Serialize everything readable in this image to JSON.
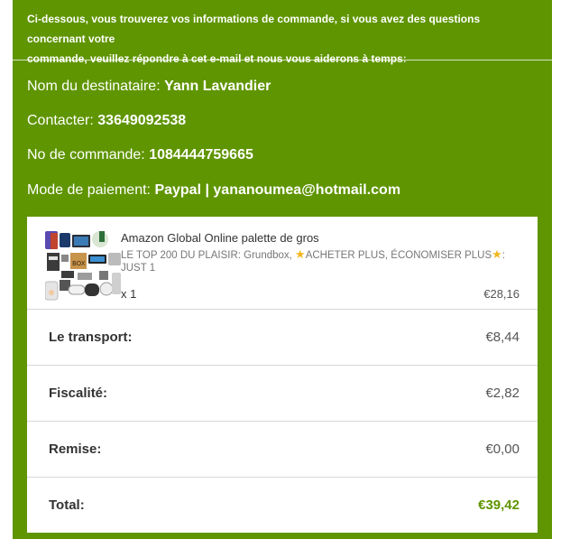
{
  "intro": {
    "line1": "Ci-dessous, vous trouverez vos informations de commande, si vous avez des questions concernant votre",
    "line2": "commande, veuillez répondre à cet e-mail et nous vous aiderons à tempsː"
  },
  "recipient": {
    "label": "Nom du destinataire:",
    "value": "Yann Lavandier"
  },
  "contact": {
    "label": "Contacter:",
    "value": "33649092538"
  },
  "order": {
    "label": "No de commande:",
    "value": "1084444759665"
  },
  "payment": {
    "label": "Mode de paiement:",
    "value": "Paypal | yananoumea@hotmail.com"
  },
  "product": {
    "image_alt": "product-bundle-image",
    "title": "Amazon Global Online palette de gros",
    "variant_part1": "LE TOP 200 DU PLAISIR: Grundbox, ",
    "variant_part2": "ACHETER PLUS, ÉCONOMISER PLUS",
    "variant_part3": ": JUST 1",
    "star_icon": "star-icon",
    "quantity": "x 1",
    "price": "€28,16"
  },
  "summary": [
    {
      "label": "Le transport:",
      "value": "€8,44"
    },
    {
      "label": "Fiscalité:",
      "value": "€2,82"
    },
    {
      "label": "Remise:",
      "value": "€0,00"
    }
  ],
  "total": {
    "label": "Total:",
    "value": "€39,42"
  },
  "colors": {
    "brand_green": "#5f9500",
    "star": "#f3b61f"
  }
}
